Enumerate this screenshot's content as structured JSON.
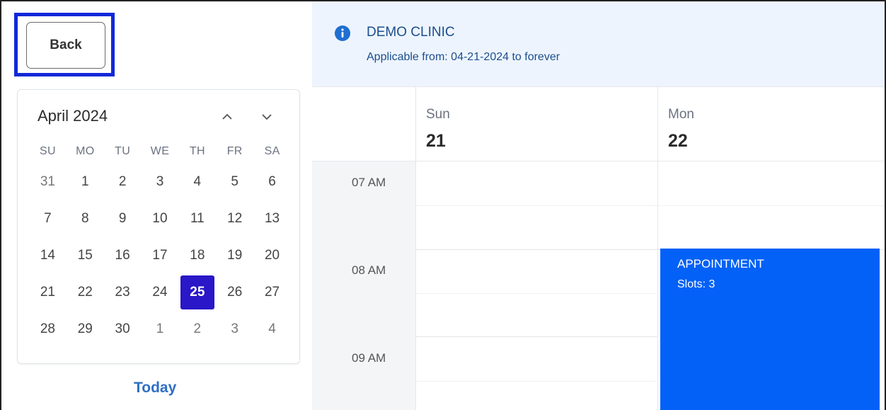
{
  "back_button": {
    "label": "Back"
  },
  "calendar": {
    "title": "April 2024",
    "weekdays": [
      "SU",
      "MO",
      "TU",
      "WE",
      "TH",
      "FR",
      "SA"
    ],
    "weeks": [
      [
        "31",
        "1",
        "2",
        "3",
        "4",
        "5",
        "6"
      ],
      [
        "7",
        "8",
        "9",
        "10",
        "11",
        "12",
        "13"
      ],
      [
        "14",
        "15",
        "16",
        "17",
        "18",
        "19",
        "20"
      ],
      [
        "21",
        "22",
        "23",
        "24",
        "25",
        "26",
        "27"
      ],
      [
        "28",
        "29",
        "30",
        "1",
        "2",
        "3",
        "4"
      ]
    ],
    "selected_day": "25",
    "prev_icon": "chevron-up-icon",
    "next_icon": "chevron-down-icon"
  },
  "today_label": "Today",
  "banner": {
    "icon": "info-icon",
    "title": "DEMO CLINIC",
    "subtitle": "Applicable from: 04-21-2024 to forever"
  },
  "schedule": {
    "days": [
      {
        "name": "Sun",
        "number": "21"
      },
      {
        "name": "Mon",
        "number": "22"
      }
    ],
    "times": [
      "07 AM",
      "08 AM",
      "09 AM"
    ],
    "event": {
      "title": "APPOINTMENT",
      "slots": "Slots: 3",
      "color": "#0361f7"
    }
  },
  "colors": {
    "selected_day": "#2917c8",
    "back_highlight": "#1128d8",
    "banner_bg": "#edf4fe",
    "banner_text": "#1c4e8c",
    "today_link": "#2f6fc4"
  }
}
